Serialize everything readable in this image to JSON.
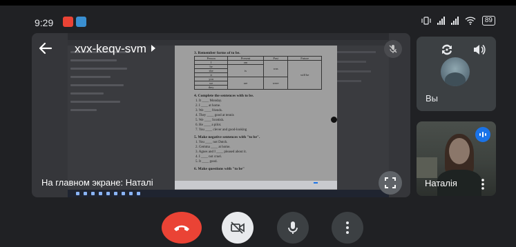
{
  "status_bar": {
    "time": "9:29",
    "apps": [
      "gmail-icon",
      "telegram-icon"
    ],
    "battery": "89"
  },
  "meeting": {
    "code": "xvx-keqv-svm",
    "presenting_label": "На главном экране: Наталі"
  },
  "self_tile": {
    "name": "Вы"
  },
  "participant_tile": {
    "name": "Наталія"
  },
  "document": {
    "sections": [
      {
        "heading": "3. Remember forms of to be.",
        "lines": []
      },
      {
        "heading": "4. Complete the sentences with to be.",
        "lines": [
          "1. It ____ Monday.",
          "2. I ____ at home.",
          "3. We ____ friends.",
          "4. They ____ good at tennis",
          "5. We ____ Scottish.",
          "6. He ____ a pilot.",
          "7. You ____ clever and good-looking"
        ]
      },
      {
        "heading": "5. Make negative sentences with \"to be\".",
        "lines": [
          "1. You ____ not Dutch.",
          "2. Gemma ____ at home.",
          "3. Agnes and I ____ pleased about it.",
          "4. I ____ not cruel.",
          "5. It ____ good."
        ]
      },
      {
        "heading": "6. Make questions with \"to be\"",
        "lines": []
      }
    ],
    "table": {
      "headers": [
        "Person",
        "Present",
        "Past",
        "Future"
      ],
      "rows": [
        [
          "I",
          "am",
          "was",
          "will be"
        ],
        [
          "he",
          "",
          "",
          ""
        ],
        [
          "she",
          "is",
          "",
          ""
        ],
        [
          "it",
          "",
          "",
          ""
        ],
        [
          "you",
          "",
          "",
          ""
        ],
        [
          "we",
          "are",
          "were",
          ""
        ],
        [
          "they",
          "",
          "",
          ""
        ]
      ]
    }
  },
  "colors": {
    "end_call": "#ea4335",
    "camera_button": "#e8eaed",
    "control_dark": "#3c4043",
    "speaking_indicator": "#1a73e8"
  }
}
